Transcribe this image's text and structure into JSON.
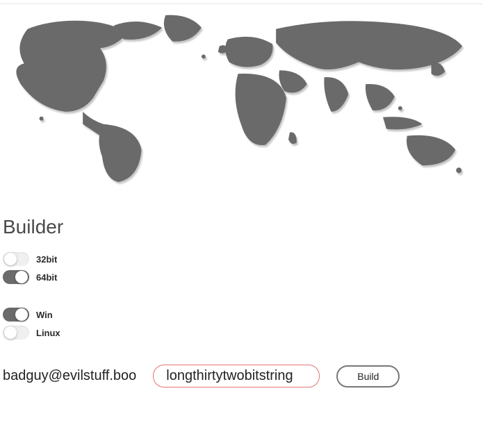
{
  "builder": {
    "title": "Builder",
    "arch": {
      "bit32": {
        "label": "32bit",
        "on": false
      },
      "bit64": {
        "label": "64bit",
        "on": true
      }
    },
    "os": {
      "win": {
        "label": "Win",
        "on": true
      },
      "linux": {
        "label": "Linux",
        "on": false
      }
    }
  },
  "footer": {
    "email": "badguy@evilstuff.boo",
    "string_value": "longthirtytwobitstring",
    "build_label": "Build"
  },
  "colors": {
    "map_fill": "#6b6b6b",
    "map_shadow": "#c8c8c8"
  }
}
